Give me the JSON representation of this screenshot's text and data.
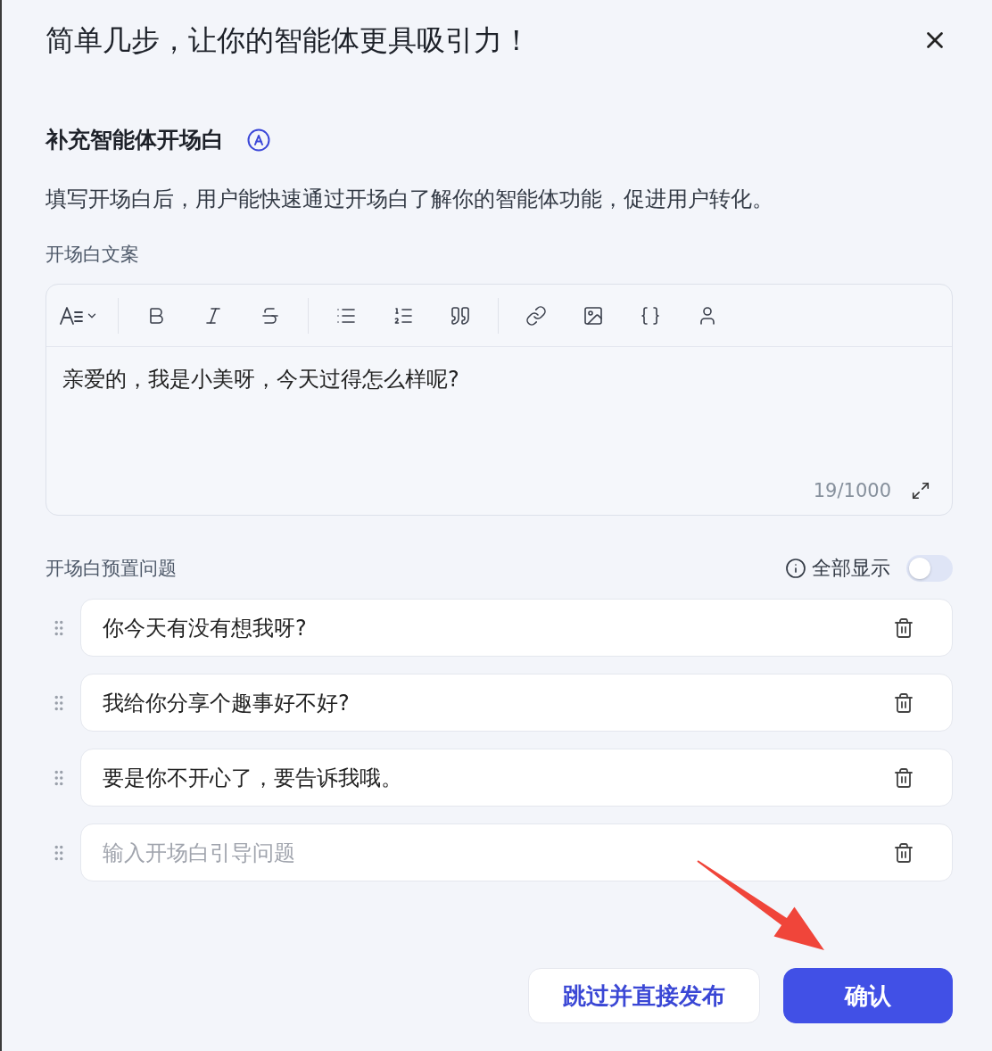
{
  "dialog": {
    "title": "简单几步，让你的智能体更具吸引力！"
  },
  "section": {
    "heading": "补充智能体开场白",
    "description": "填写开场白后，用户能快速通过开场白了解你的智能体功能，促进用户转化。"
  },
  "opening_text": {
    "label": "开场白文案",
    "value": "亲爱的，我是小美呀，今天过得怎么样呢?",
    "counter": "19/1000"
  },
  "preset_questions": {
    "label": "开场白预置问题",
    "show_all": {
      "label": "全部显示",
      "on": false
    },
    "items": [
      {
        "value": "你今天有没有想我呀?"
      },
      {
        "value": "我给你分享个趣事好不好?"
      },
      {
        "value": "要是你不开心了，要告诉我哦。"
      },
      {
        "placeholder": "输入开场白引导问题"
      }
    ]
  },
  "buttons": [
    {
      "label": "跳过并直接发布",
      "kind": "secondary"
    },
    {
      "label": "确认",
      "kind": "primary"
    }
  ]
}
